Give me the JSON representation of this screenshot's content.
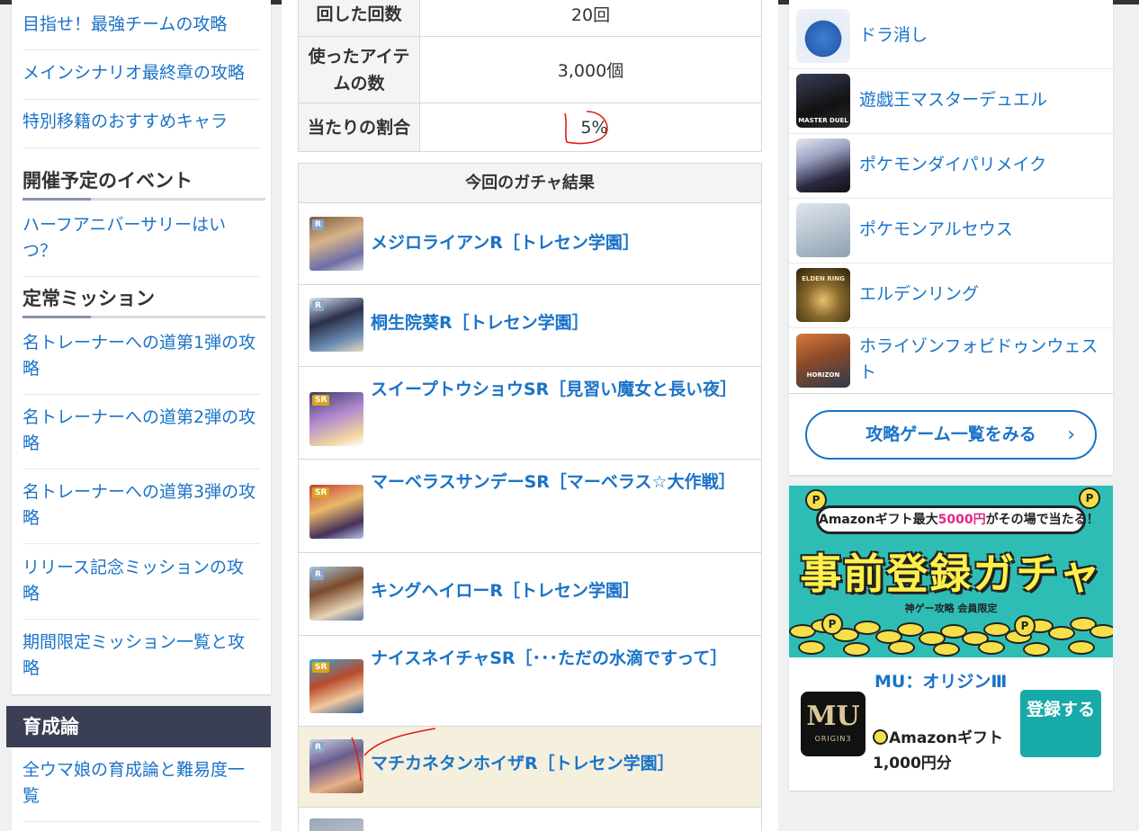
{
  "left": {
    "links_top": [
      "目指せ！最強チームの攻略",
      "メインシナリオ最終章の攻略",
      "特別移籍のおすすめキャラ"
    ],
    "events_heading": "開催予定のイベント",
    "events_links": [
      "ハーフアニバーサリーはいつ？"
    ],
    "missions_heading": "定常ミッション",
    "missions_links": [
      "名トレーナーへの道第1弾の攻略",
      "名トレーナーへの道第2弾の攻略",
      "名トレーナーへの道第3弾の攻略",
      "リリース記念ミッションの攻略",
      "期間限定ミッション一覧と攻略"
    ],
    "section_title": "育成論",
    "section_links": [
      "全ウマ娘の育成論と難易度一覧"
    ]
  },
  "stats": {
    "rows": [
      {
        "label": "回した回数",
        "value": "20回"
      },
      {
        "label": "使ったアイテムの数",
        "value": "3,000個"
      },
      {
        "label": "当たりの割合",
        "value": "5%"
      }
    ]
  },
  "gacha": {
    "header": "今回のガチャ結果",
    "results": [
      {
        "name": "メジロライアンR［トレセン学園］",
        "rarity": "R"
      },
      {
        "name": "桐生院葵R［トレセン学園］",
        "rarity": "R"
      },
      {
        "name": "スイープトウショウSR［見習い魔女と長い夜］",
        "rarity": "SR"
      },
      {
        "name": "マーベラスサンデーSR［マーベラス☆大作戦］",
        "rarity": "SR"
      },
      {
        "name": "キングヘイローR［トレセン学園］",
        "rarity": "R"
      },
      {
        "name": "ナイスネイチャSR［･･･ただの水滴ですって］",
        "rarity": "SR"
      },
      {
        "name": "マチカネタンホイザR［トレセン学園］",
        "rarity": "R"
      }
    ]
  },
  "games": {
    "items": [
      {
        "title": "ドラ消し",
        "icon": "slime-icon",
        "color": "#3d7fd6"
      },
      {
        "title": "遊戯王マスターデュエル",
        "icon": "master-duel-icon",
        "color": "#1b1f2a"
      },
      {
        "title": "ポケモンダイパリメイク",
        "icon": "dialga-icon",
        "color": "#222233"
      },
      {
        "title": "ポケモンアルセウス",
        "icon": "arceus-icon",
        "color": "#c9d3dc"
      },
      {
        "title": "エルデンリング",
        "icon": "elden-ring-icon",
        "color": "#4a3a1c"
      },
      {
        "title": "ホライゾンフォビドゥンウェスト",
        "icon": "horizon-icon",
        "color": "#8a5a3a"
      }
    ],
    "more_label": "攻略ゲーム一覧をみる",
    "icon_caption_master_duel": "MASTER DUEL",
    "icon_caption_elden": "ELDEN RING",
    "icon_caption_horizon": "HORIZON"
  },
  "banner": {
    "strip_prefix": "Amazonギフト最大",
    "strip_amount": "5000円",
    "strip_suffix": "がその場で当たる！",
    "title": "事前登録ガチャ",
    "sub": "神ゲー攻略 会員限定",
    "coin_letter": "P"
  },
  "register": {
    "game_title": "MU：オリジンⅢ",
    "icon_text": "MU",
    "icon_sub": "ORIGIN3",
    "gift": "Amazonギフト1,000円分",
    "button": "登録する"
  },
  "colors": {
    "link": "#1a73c8",
    "annotation": "#e21b1b",
    "highlight_row": "#f5f0de"
  }
}
